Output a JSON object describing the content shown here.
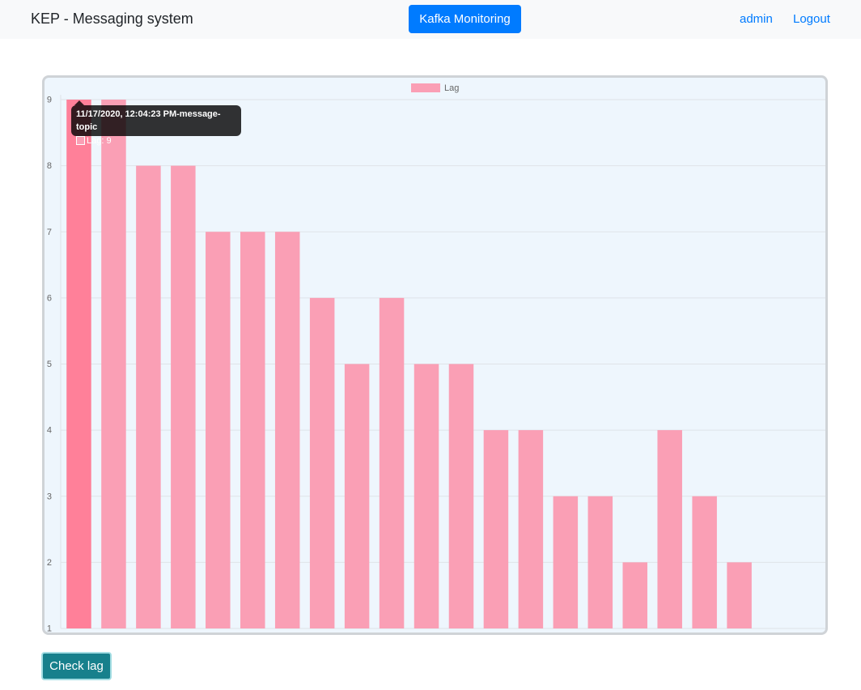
{
  "navbar": {
    "brand": "KEP - Messaging system",
    "monitor_button": "Kafka Monitoring",
    "user_link": "admin",
    "logout_link": "Logout"
  },
  "tooltip": {
    "title": "11/17/2020, 12:04:23 PM-message-topic",
    "body": "Lag: 9"
  },
  "actions": {
    "check_lag": "Check lag"
  },
  "colors": {
    "bar_fill": "#fa9fb5",
    "bar_hover": "#ff8099",
    "primary": "#007bff",
    "info": "#17808c"
  },
  "chart_data": {
    "type": "bar",
    "series": [
      {
        "name": "Lag",
        "values": [
          9,
          9,
          8,
          8,
          7,
          7,
          7,
          6,
          5,
          6,
          5,
          5,
          4,
          4,
          3,
          3,
          2,
          4,
          3,
          2
        ]
      }
    ],
    "category_count": 22,
    "y_ticks": [
      "1",
      "2",
      "3",
      "4",
      "5",
      "6",
      "7",
      "8",
      "9"
    ],
    "ylim": [
      1,
      9
    ],
    "grid": true,
    "legend_position": "top",
    "highlighted_index": 0
  }
}
